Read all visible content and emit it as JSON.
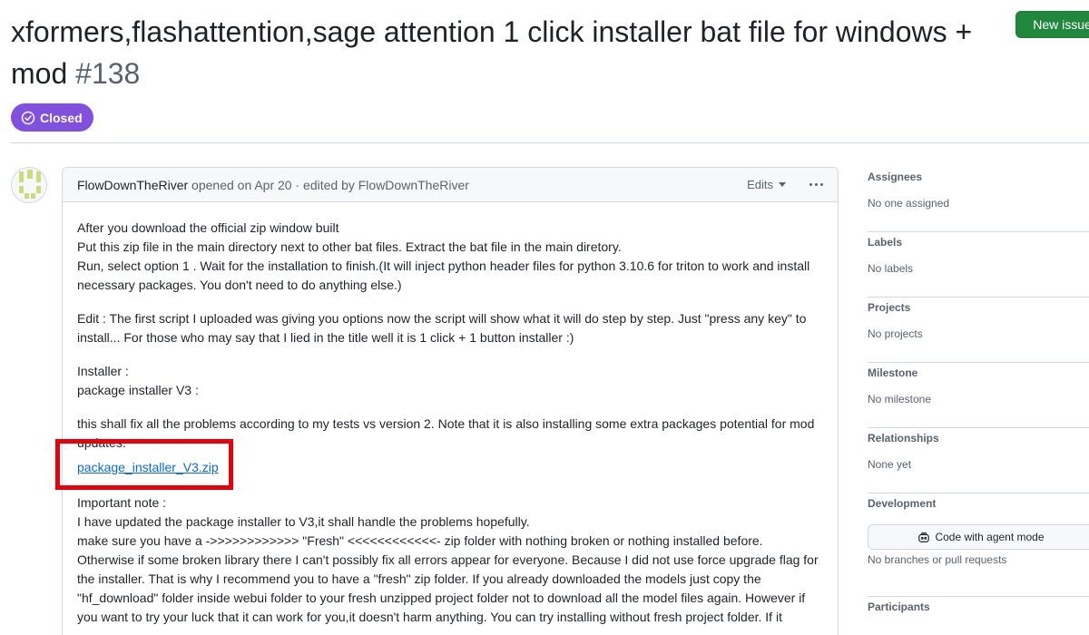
{
  "issue": {
    "title": "xformers,flashattention,sage attention 1 click installer bat file for windows + mod",
    "number": "#138",
    "state": "Closed",
    "new_issue_label": "New issue"
  },
  "comment": {
    "author": "FlowDownTheRiver",
    "opened_text": "opened on Apr 20 · edited by",
    "editor": "FlowDownTheRiver",
    "edits_label": "Edits",
    "body": {
      "intro": [
        "After you download the official zip window built",
        "Put this zip file in the main directory next to other bat files. Extract the bat file in the main diretory.",
        "Run, select option 1 . Wait for the installation to finish.(It will inject python header files for python 3.10.6 for triton to work and install necessary packages. You don't need to do anything else.)"
      ],
      "edit_note": "Edit : The first script I uploaded was giving you options now the script will show what it will do step by step. Just \"press any key\" to install... For those who may say that I lied in the title well it is 1 click + 1 button installer :)",
      "installer_label": "Installer :",
      "package_label": "package installer V3 :",
      "fix_note": "this shall fix all the problems according to my tests vs version 2. Note that it is also installing some extra packages potential for mod updates.",
      "link_text": "package_installer_V3.zip",
      "important_label": "Important note :",
      "important_lines": [
        "I have updated the package installer to V3,it shall handle the problems hopefully.",
        "make sure you have a ->>>>>>>>>>>> \"Fresh\" <<<<<<<<<<<<- zip folder with nothing broken or nothing installed before. Otherwise if some broken library there I can't possibly fix all errors appear for everyone. Because I did not use force upgrade flag for the installer. That is why I recommend you to have a \"fresh\" zip folder. If you already downloaded the models just copy the \"hf_download\" folder inside webui folder to your fresh unzipped project folder not to download all the model files again. However if you want to try your luck that it can work for you,it doesn't harm anything. You can try installing without fresh project folder. If it"
      ]
    }
  },
  "sidebar": {
    "assignees": {
      "title": "Assignees",
      "value": "No one assigned"
    },
    "labels": {
      "title": "Labels",
      "value": "No labels"
    },
    "projects": {
      "title": "Projects",
      "value": "No projects"
    },
    "milestone": {
      "title": "Milestone",
      "value": "No milestone"
    },
    "relationships": {
      "title": "Relationships",
      "value": "None yet"
    },
    "development": {
      "title": "Development",
      "button_label": "Code with agent mode",
      "value": "No branches or pull requests"
    },
    "participants": {
      "title": "Participants"
    }
  },
  "colors": {
    "closed_badge": "#8250df",
    "new_issue_button": "#1f883d",
    "highlight_box": "#e8000b",
    "link": "#0969da"
  }
}
